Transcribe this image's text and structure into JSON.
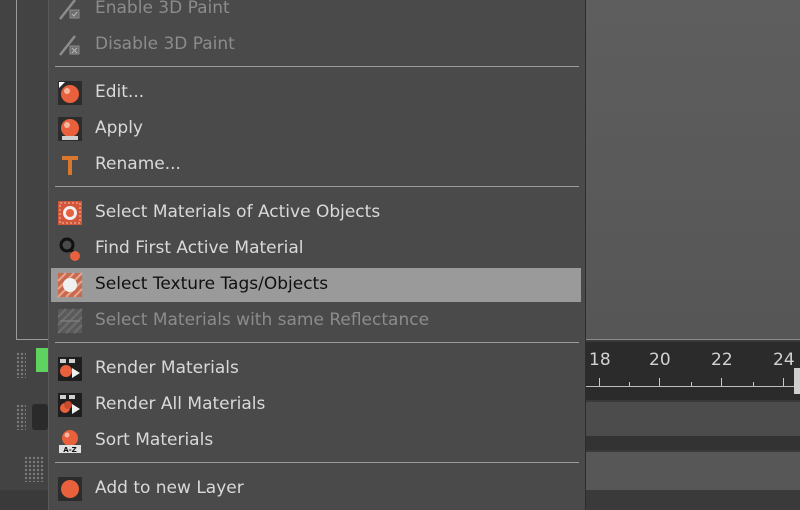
{
  "menu": {
    "items": [
      {
        "label": "Enable 3D Paint",
        "icon": "paint-3d-enable-icon",
        "state": "disabled"
      },
      {
        "label": "Disable 3D Paint",
        "icon": "paint-3d-disable-icon",
        "state": "disabled"
      },
      {
        "label": "Edit...",
        "icon": "material-edit-icon",
        "state": "enabled"
      },
      {
        "label": "Apply",
        "icon": "material-apply-icon",
        "state": "enabled"
      },
      {
        "label": "Rename...",
        "icon": "rename-text-icon",
        "state": "enabled"
      },
      {
        "label": "Select Materials of Active Objects",
        "icon": "select-material-icon",
        "state": "enabled"
      },
      {
        "label": "Find First Active Material",
        "icon": "find-material-icon",
        "state": "enabled"
      },
      {
        "label": "Select Texture Tags/Objects",
        "icon": "select-texture-tag-icon",
        "state": "highlighted"
      },
      {
        "label": "Select Materials with same Reflectance",
        "icon": "reflectance-icon",
        "state": "disabled"
      },
      {
        "label": "Render Materials",
        "icon": "render-material-icon",
        "state": "enabled"
      },
      {
        "label": "Render All Materials",
        "icon": "render-all-materials-icon",
        "state": "enabled"
      },
      {
        "label": "Sort Materials",
        "icon": "sort-materials-icon",
        "state": "enabled"
      },
      {
        "label": "Add to new Layer",
        "icon": "add-layer-icon",
        "state": "enabled"
      }
    ]
  },
  "timeline": {
    "frame_labels": [
      "18",
      "20",
      "22",
      "24"
    ]
  },
  "colors": {
    "menu_background": "#4a4a4a",
    "highlight": "#9a9a9a",
    "icon_accent": "#e8603c",
    "text": "#d9d9d9",
    "text_disabled": "#8c8c8c"
  }
}
